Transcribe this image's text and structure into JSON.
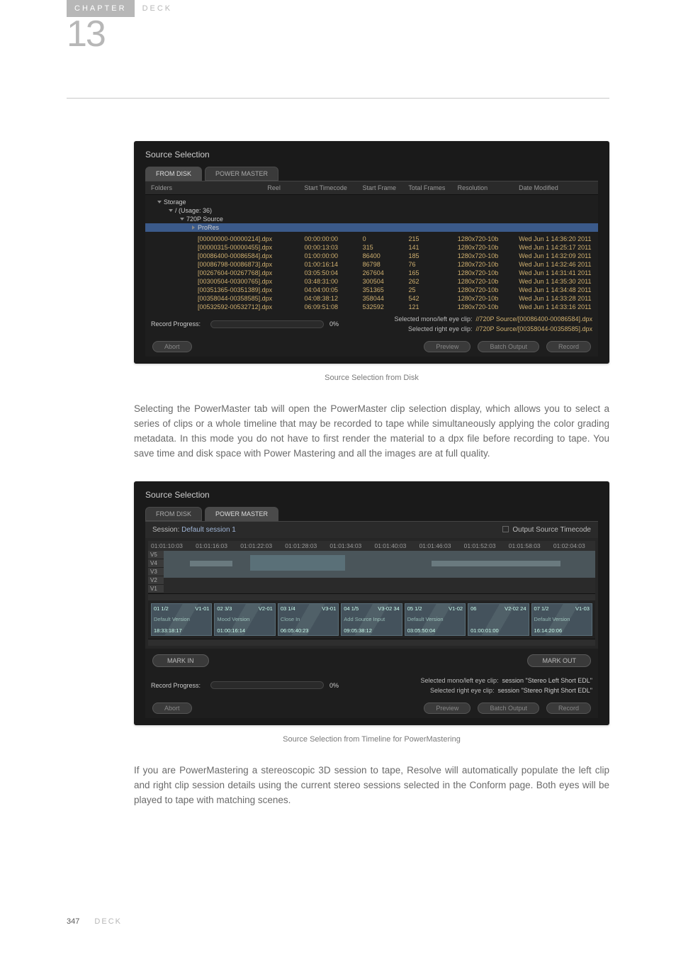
{
  "chapter": {
    "label": "CHAPTER",
    "title": "DECK",
    "number": "13"
  },
  "ss1": {
    "title": "Source Selection",
    "tabs": [
      "FROM DISK",
      "POWER MASTER"
    ],
    "headers": [
      "Folders",
      "Reel",
      "Start Timecode",
      "Start Frame",
      "Total Frames",
      "Resolution",
      "Date Modified"
    ],
    "tree": {
      "storage": "Storage",
      "usage": "/ (Usage: 36)",
      "src": "720P Source",
      "prores": "ProRes"
    },
    "rows": [
      {
        "fn": "[00000000-00000214].dpx",
        "tc": "00:00:00:00",
        "sf": "0",
        "tf": "215",
        "res": "1280x720-10b",
        "dm": "Wed Jun 1 14:36:20 2011"
      },
      {
        "fn": "[00000315-00000455].dpx",
        "tc": "00:00:13:03",
        "sf": "315",
        "tf": "141",
        "res": "1280x720-10b",
        "dm": "Wed Jun 1 14:25:17 2011"
      },
      {
        "fn": "[00086400-00086584].dpx",
        "tc": "01:00:00:00",
        "sf": "86400",
        "tf": "185",
        "res": "1280x720-10b",
        "dm": "Wed Jun 1 14:32:09 2011"
      },
      {
        "fn": "[00086798-00086873].dpx",
        "tc": "01:00:16:14",
        "sf": "86798",
        "tf": "76",
        "res": "1280x720-10b",
        "dm": "Wed Jun 1 14:32:46 2011"
      },
      {
        "fn": "[00267604-00267768].dpx",
        "tc": "03:05:50:04",
        "sf": "267604",
        "tf": "165",
        "res": "1280x720-10b",
        "dm": "Wed Jun 1 14:31:41 2011"
      },
      {
        "fn": "[00300504-00300765].dpx",
        "tc": "03:48:31:00",
        "sf": "300504",
        "tf": "262",
        "res": "1280x720-10b",
        "dm": "Wed Jun 1 14:35:30 2011"
      },
      {
        "fn": "[00351365-00351389].dpx",
        "tc": "04:04:00:05",
        "sf": "351365",
        "tf": "25",
        "res": "1280x720-10b",
        "dm": "Wed Jun 1 14:34:48 2011"
      },
      {
        "fn": "[00358044-00358585].dpx",
        "tc": "04:08:38:12",
        "sf": "358044",
        "tf": "542",
        "res": "1280x720-10b",
        "dm": "Wed Jun 1 14:33:28 2011"
      },
      {
        "fn": "[00532592-00532712].dpx",
        "tc": "06:09:51:08",
        "sf": "532592",
        "tf": "121",
        "res": "1280x720-10b",
        "dm": "Wed Jun 1 14:33:16 2011"
      }
    ],
    "progress_label": "Record Progress:",
    "progress_value": "0%",
    "sel_left_label": "Selected mono/left eye clip:",
    "sel_left_val": "//720P Source/[00086400-00086584].dpx",
    "sel_right_label": "Selected right eye clip:",
    "sel_right_val": "//720P Source/[00358044-00358585].dpx",
    "btns": {
      "abort": "Abort",
      "preview": "Preview",
      "batch": "Batch Output",
      "record": "Record"
    }
  },
  "caption1": "Source Selection from Disk",
  "para1": "Selecting the PowerMaster tab will open the PowerMaster clip selection display, which allows you to select a series of clips or a whole timeline that may be recorded to tape while simultaneously applying the color grading metadata. In this mode you do not have to first render the material to a dpx file before recording to tape. You save time and disk space with Power Mastering and all the images are at full quality.",
  "ss2": {
    "title": "Source Selection",
    "tabs": [
      "FROM DISK",
      "POWER MASTER"
    ],
    "session_label": "Session:",
    "session_val": "Default session 1",
    "output_tc_label": "Output Source Timecode",
    "ruler": [
      "01:01:10:03",
      "01:01:16:03",
      "01:01:22:03",
      "01:01:28:03",
      "01:01:34:03",
      "01:01:40:03",
      "01:01:46:03",
      "01:01:52:03",
      "01:01:58:03",
      "01:02:04:03"
    ],
    "tracks": [
      "V5",
      "V4",
      "V3",
      "V2",
      "V1"
    ],
    "clips": [
      {
        "t": "01 1/2",
        "v": "V1-01",
        "d": "Default Version",
        "tc": "18:33:18:17"
      },
      {
        "t": "02 3/3",
        "v": "V2-01",
        "d": "Mood Version",
        "tc": "01:00:16:14"
      },
      {
        "t": "03 1/4",
        "v": "V3-01",
        "d": "Close In",
        "tc": "06:05:40:23"
      },
      {
        "t": "04 1/5",
        "v": "V3-02 34",
        "d": "Add Source Input",
        "tc": "09:05:38:12"
      },
      {
        "t": "05 1/2",
        "v": "V1-02",
        "d": "Default Version",
        "tc": "03:05:50:04"
      },
      {
        "t": "06",
        "v": "V2-02 24",
        "d": "",
        "tc": "01:00:01:00"
      },
      {
        "t": "07 1/2",
        "v": "V1-03",
        "d": "Default Version",
        "tc": "16:14:20:06"
      }
    ],
    "mark_in": "MARK IN",
    "mark_out": "MARK OUT",
    "progress_label": "Record Progress:",
    "progress_value": "0%",
    "sel_left_label": "Selected mono/left eye clip:",
    "sel_left_val": "session \"Stereo Left Short EDL\"",
    "sel_right_label": "Selected right eye clip:",
    "sel_right_val": "session \"Stereo Right Short EDL\"",
    "btns": {
      "abort": "Abort",
      "preview": "Preview",
      "batch": "Batch Output",
      "record": "Record"
    }
  },
  "caption2": "Source Selection from Timeline for PowerMastering",
  "para2": "If you are PowerMastering a stereoscopic 3D session to tape, Resolve will automatically populate the left clip and right clip session details using the current stereo sessions selected in the Conform page. Both eyes will be played to tape with matching scenes.",
  "footer": {
    "page": "347",
    "label": "DECK"
  }
}
